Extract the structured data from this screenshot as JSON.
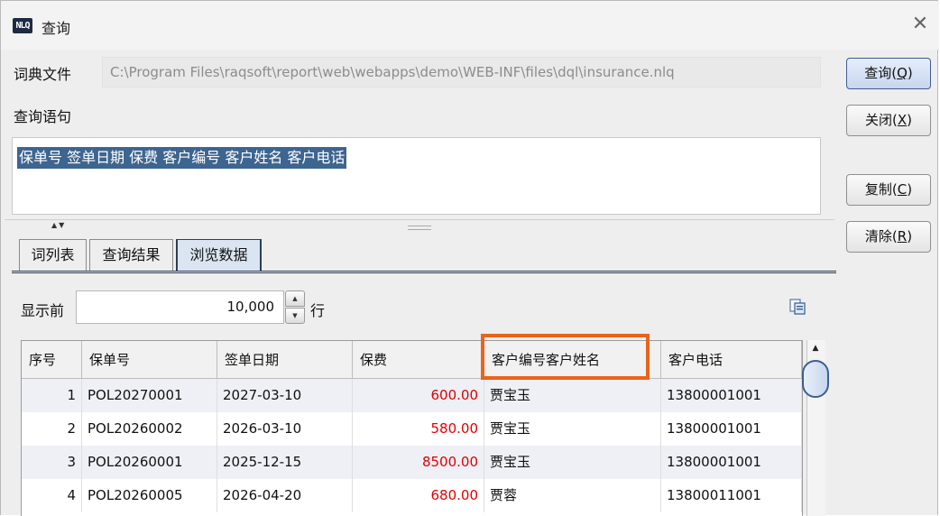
{
  "window": {
    "logo_text": "NLQ",
    "title": "查询",
    "close_glyph": "✕"
  },
  "form": {
    "dict_label": "词典文件",
    "dict_path": "C:\\Program Files\\raqsoft\\report\\web\\webapps\\demo\\WEB-INF\\files\\dql\\insurance.nlq",
    "query_label": "查询语句",
    "query_text": "保单号 签单日期 保费 客户编号 客户姓名 客户电话"
  },
  "buttons": {
    "query": {
      "label": "查询",
      "mnemonic": "Q"
    },
    "close": {
      "label": "关闭",
      "mnemonic": "X"
    },
    "copy": {
      "label": "复制",
      "mnemonic": "C"
    },
    "clear": {
      "label": "清除",
      "mnemonic": "R"
    }
  },
  "tabs": [
    "词列表",
    "查询结果",
    "浏览数据"
  ],
  "active_tab": "浏览数据",
  "browse": {
    "show_first_label": "显示前",
    "row_count": "10,000",
    "rows_unit": "行"
  },
  "table": {
    "columns": [
      "序号",
      "保单号",
      "签单日期",
      "保费",
      "客户编号客户姓名",
      "客户电话"
    ],
    "highlighted_column": "客户编号客户姓名",
    "rows": [
      [
        "1",
        "POL20270001",
        "2027-03-10",
        "600.00",
        "贾宝玉",
        "13800001001"
      ],
      [
        "2",
        "POL20260002",
        "2026-03-10",
        "580.00",
        "贾宝玉",
        "13800001001"
      ],
      [
        "3",
        "POL20260001",
        "2025-12-15",
        "8500.00",
        "贾宝玉",
        "13800001001"
      ],
      [
        "4",
        "POL20260005",
        "2026-04-20",
        "680.00",
        "贾蓉",
        "13800011001"
      ]
    ]
  },
  "colors": {
    "accent": "#3d6590",
    "premium_text": "#e00000",
    "highlight_box": "#e8641c"
  }
}
